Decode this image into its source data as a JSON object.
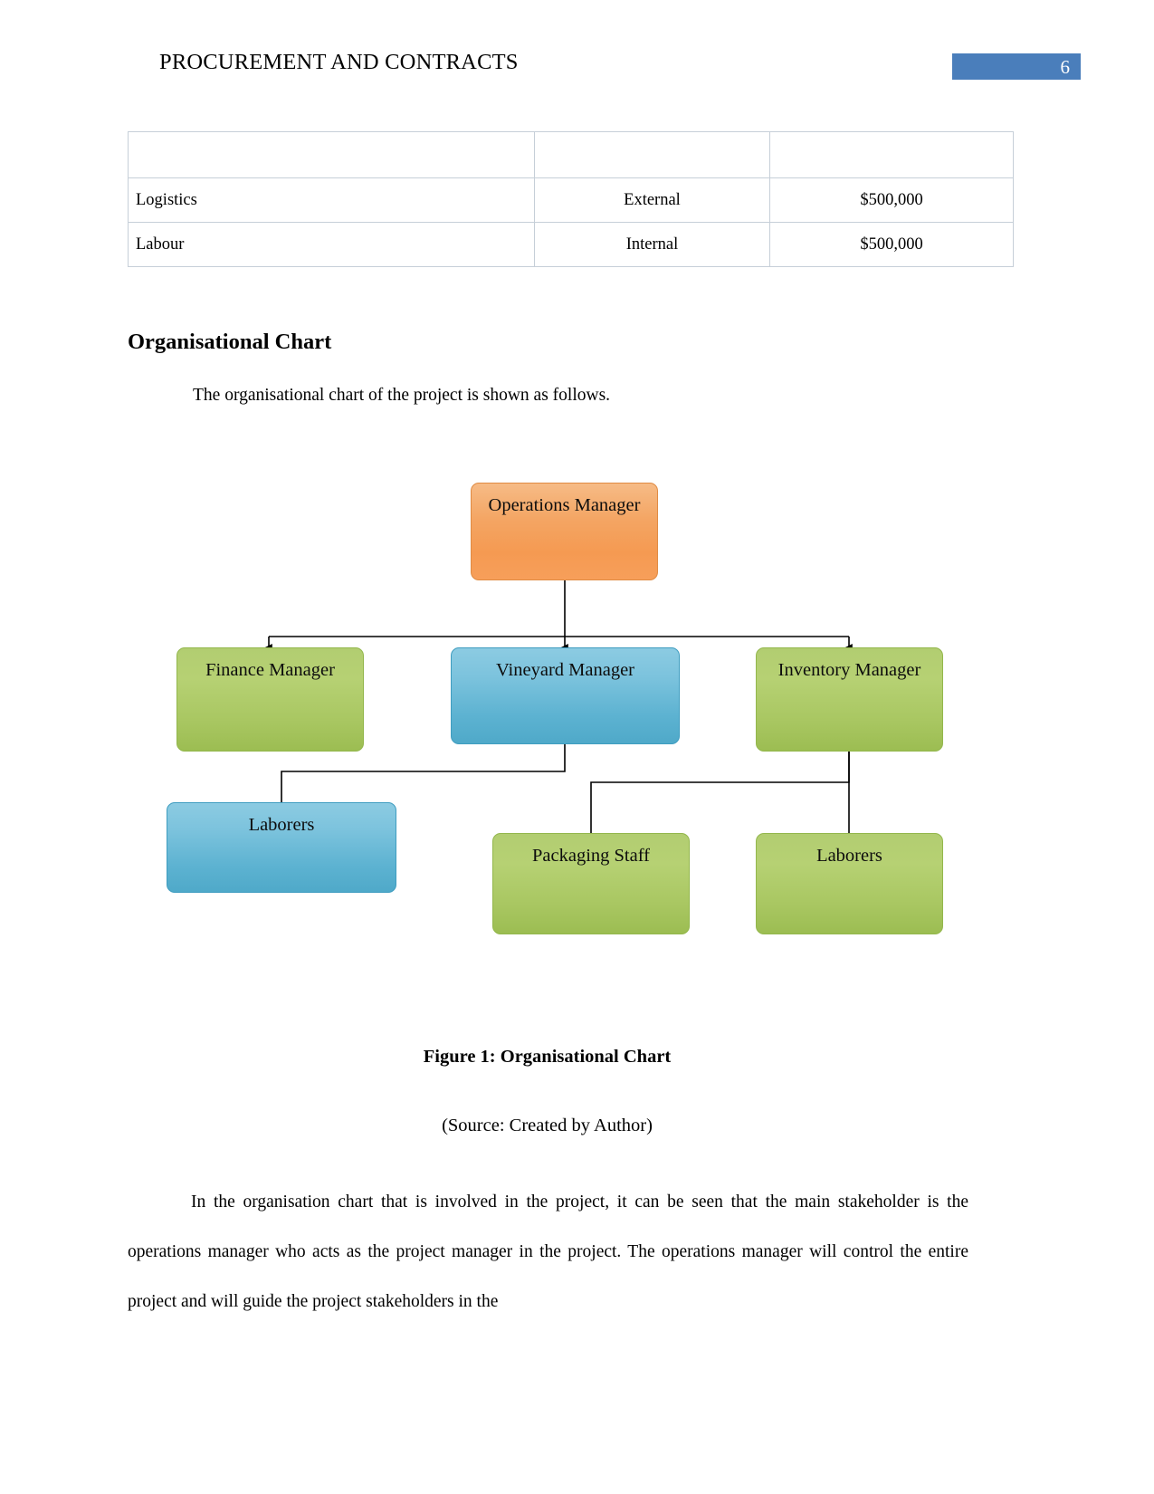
{
  "header": {
    "title": "PROCUREMENT AND CONTRACTS",
    "page_number": "6",
    "badge_color": "#4a7ebb"
  },
  "table": {
    "columns": [
      "",
      "",
      ""
    ],
    "rows": [
      {
        "name": "",
        "type": "",
        "cost": ""
      },
      {
        "name": "Logistics",
        "type": "External",
        "cost": "$500,000"
      },
      {
        "name": "Labour",
        "type": "Internal",
        "cost": "$500,000"
      }
    ]
  },
  "section": {
    "heading": "Organisational Chart",
    "intro": "The organisational chart of the project is shown as follows."
  },
  "chart_data": {
    "type": "diagram",
    "title": "Organisational Chart",
    "nodes": [
      {
        "id": "operations-manager",
        "label": "Operations Manager",
        "color": "#f4a563",
        "level": 0
      },
      {
        "id": "finance-manager",
        "label": "Finance Manager",
        "color": "#b2cd71",
        "level": 1
      },
      {
        "id": "vineyard-manager",
        "label": "Vineyard Manager",
        "color": "#7cc3dd",
        "level": 1
      },
      {
        "id": "inventory-manager",
        "label": "Inventory Manager",
        "color": "#b2cd71",
        "level": 1
      },
      {
        "id": "laborers-left",
        "label": "Laborers",
        "color": "#7cc3dd",
        "level": 2
      },
      {
        "id": "packaging-staff",
        "label": "Packaging Staff",
        "color": "#b2cd71",
        "level": 2
      },
      {
        "id": "laborers-right",
        "label": "Laborers",
        "color": "#b2cd71",
        "level": 2
      }
    ],
    "edges": [
      {
        "from": "operations-manager",
        "to": "finance-manager"
      },
      {
        "from": "operations-manager",
        "to": "vineyard-manager"
      },
      {
        "from": "operations-manager",
        "to": "inventory-manager"
      },
      {
        "from": "vineyard-manager",
        "to": "laborers-left"
      },
      {
        "from": "inventory-manager",
        "to": "packaging-staff"
      },
      {
        "from": "inventory-manager",
        "to": "laborers-right"
      }
    ]
  },
  "figure": {
    "caption": "Figure 1: Organisational Chart",
    "source": "(Source: Created by Author)"
  },
  "body": {
    "paragraph": "In the organisation chart that is involved in the project, it can be seen that the main stakeholder is the operations manager who acts as the project manager in the project. The operations manager will control the entire project and will guide the project stakeholders in the"
  }
}
